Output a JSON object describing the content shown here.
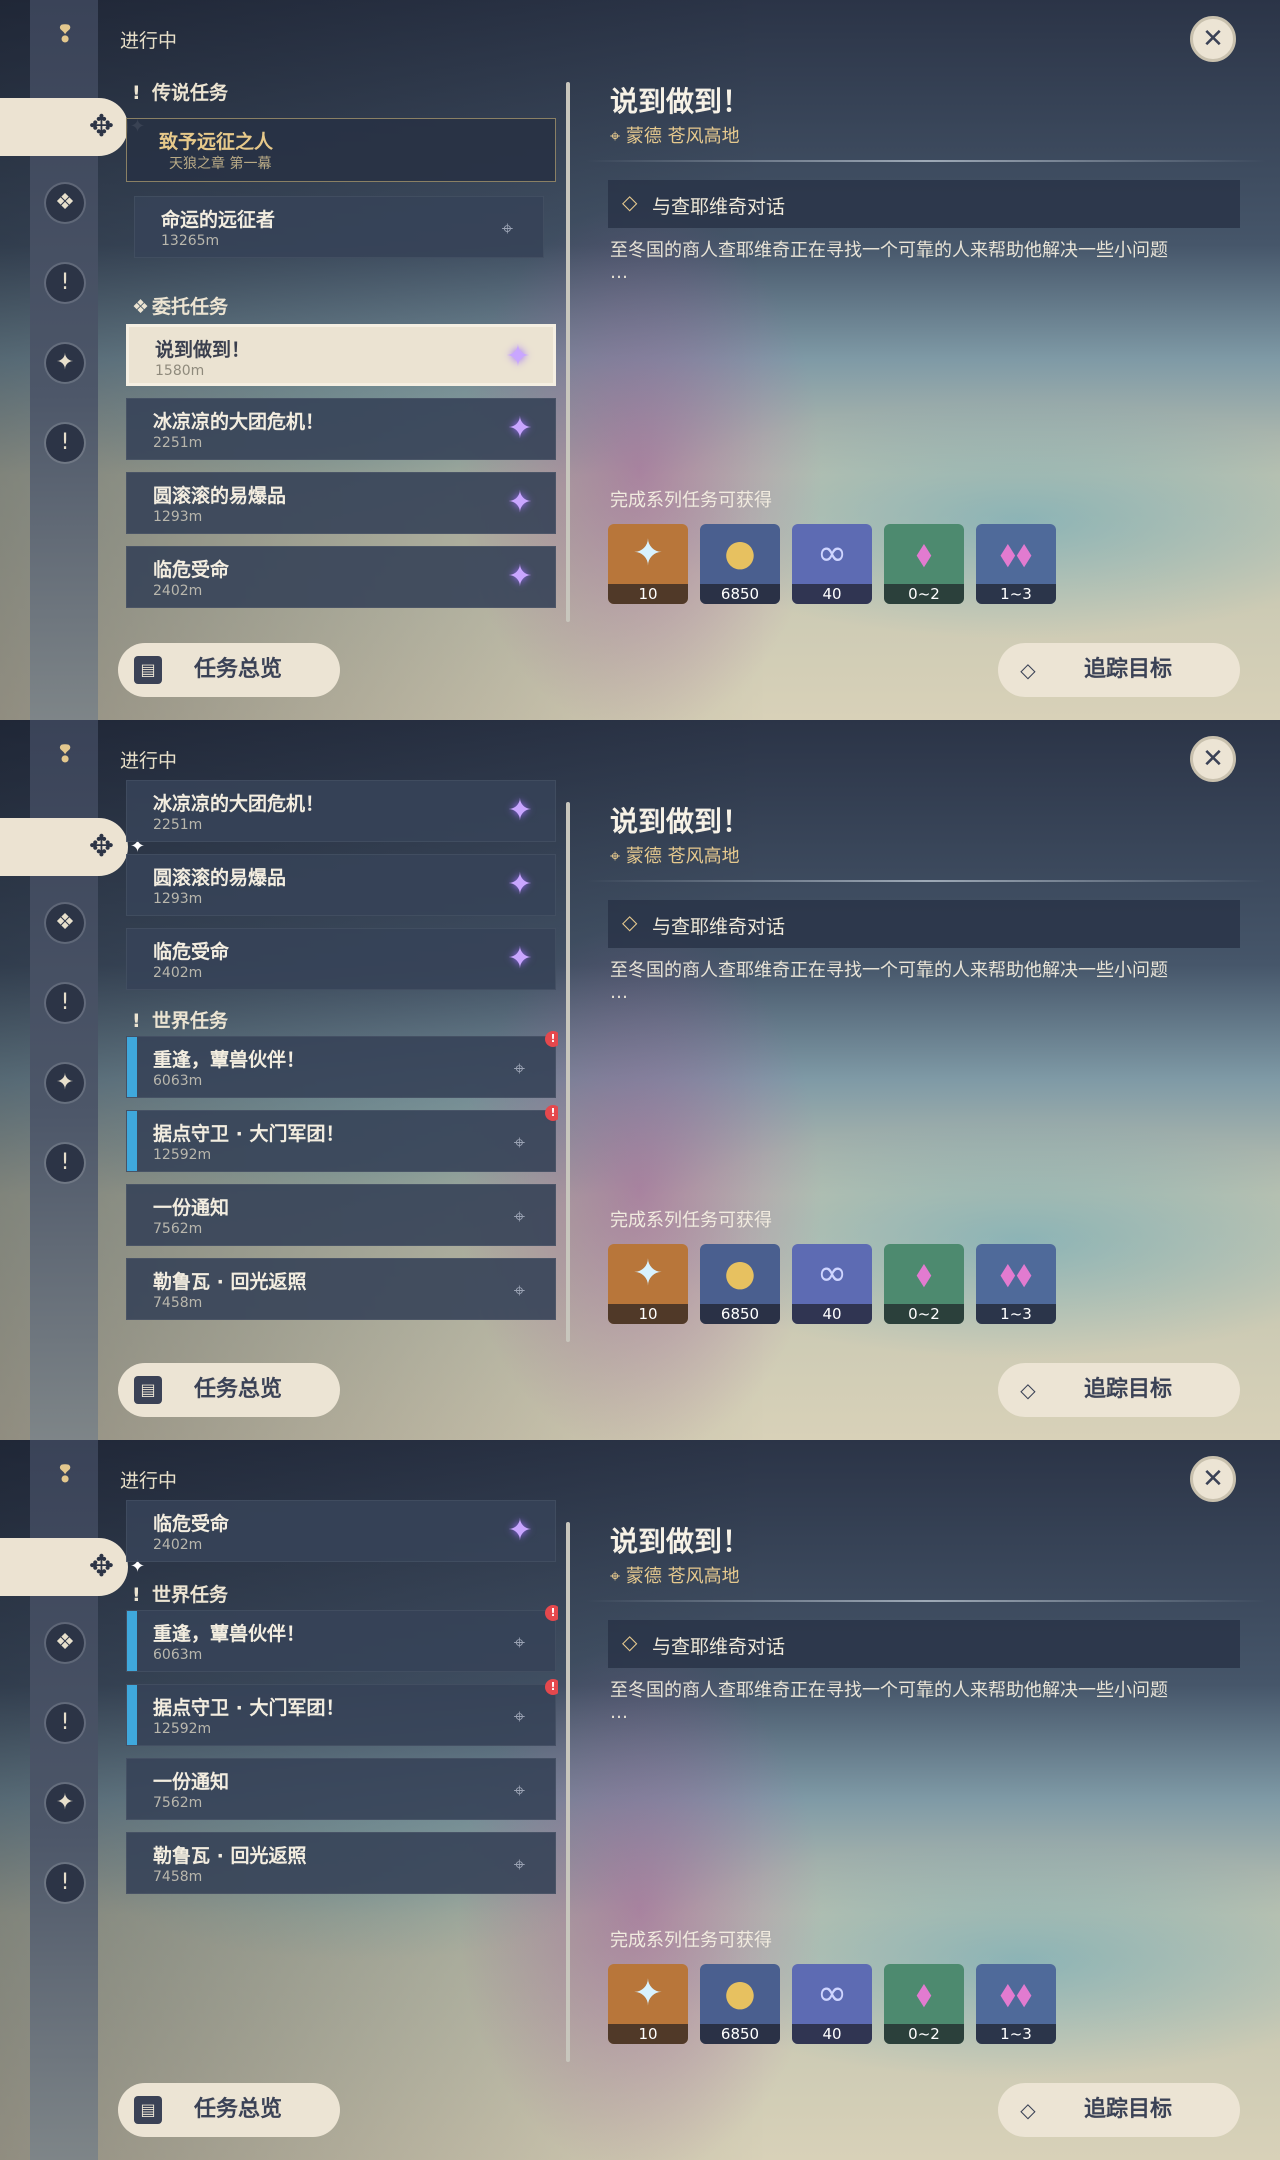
{
  "header": {
    "in_progress": "进行中",
    "close_icon": "close-icon"
  },
  "sidebar": {
    "icons": [
      "bookmark-icon",
      "all-quests-icon",
      "archon-quest-icon",
      "legend-quest-icon",
      "world-quest-icon",
      "exclamation-icon"
    ]
  },
  "sections": {
    "legend": "传说任务",
    "commission": "委托任务",
    "world": "世界任务"
  },
  "legend_quest": {
    "title": "致予远征之人",
    "sub": "天狼之章 第一幕",
    "step_title": "命运的远征者",
    "step_dist": "13265m"
  },
  "commissions": [
    {
      "title": "说到做到！",
      "dist": "1580m"
    },
    {
      "title": "冰凉凉的大团危机！",
      "dist": "2251m"
    },
    {
      "title": "圆滚滚的易爆品",
      "dist": "1293m"
    },
    {
      "title": "临危受命",
      "dist": "2402m"
    }
  ],
  "world_quests": [
    {
      "title": "重逢，蕈兽伙伴！",
      "dist": "6063m"
    },
    {
      "title": "据点守卫 · 大门军团！",
      "dist": "12592m"
    },
    {
      "title": "一份通知",
      "dist": "7562m"
    },
    {
      "title": "勒鲁瓦 · 回光返照",
      "dist": "7458m"
    }
  ],
  "detail": {
    "title": "说到做到！",
    "location": "蒙德 苍风高地",
    "objective": "与查耶维奇对话",
    "description": "至冬国的商人查耶维奇正在寻找一个可靠的人来帮助他解决一些小问题",
    "ellipsis": "…",
    "rewards_title": "完成系列任务可获得",
    "rewards": [
      {
        "icon": "primogem-icon",
        "amount": "10",
        "bg": "#b8763a"
      },
      {
        "icon": "mora-icon",
        "amount": "6850",
        "bg": "#4a5f8f"
      },
      {
        "icon": "adventure-exp-icon",
        "amount": "40",
        "bg": "#5d6bb3"
      },
      {
        "icon": "crystal-icon",
        "amount": "0~2",
        "bg": "#4d8a6f"
      },
      {
        "icon": "crystal-cluster-icon",
        "amount": "1~3",
        "bg": "#4f6a9a"
      }
    ]
  },
  "buttons": {
    "overview": "任务总览",
    "track": "追踪目标"
  }
}
